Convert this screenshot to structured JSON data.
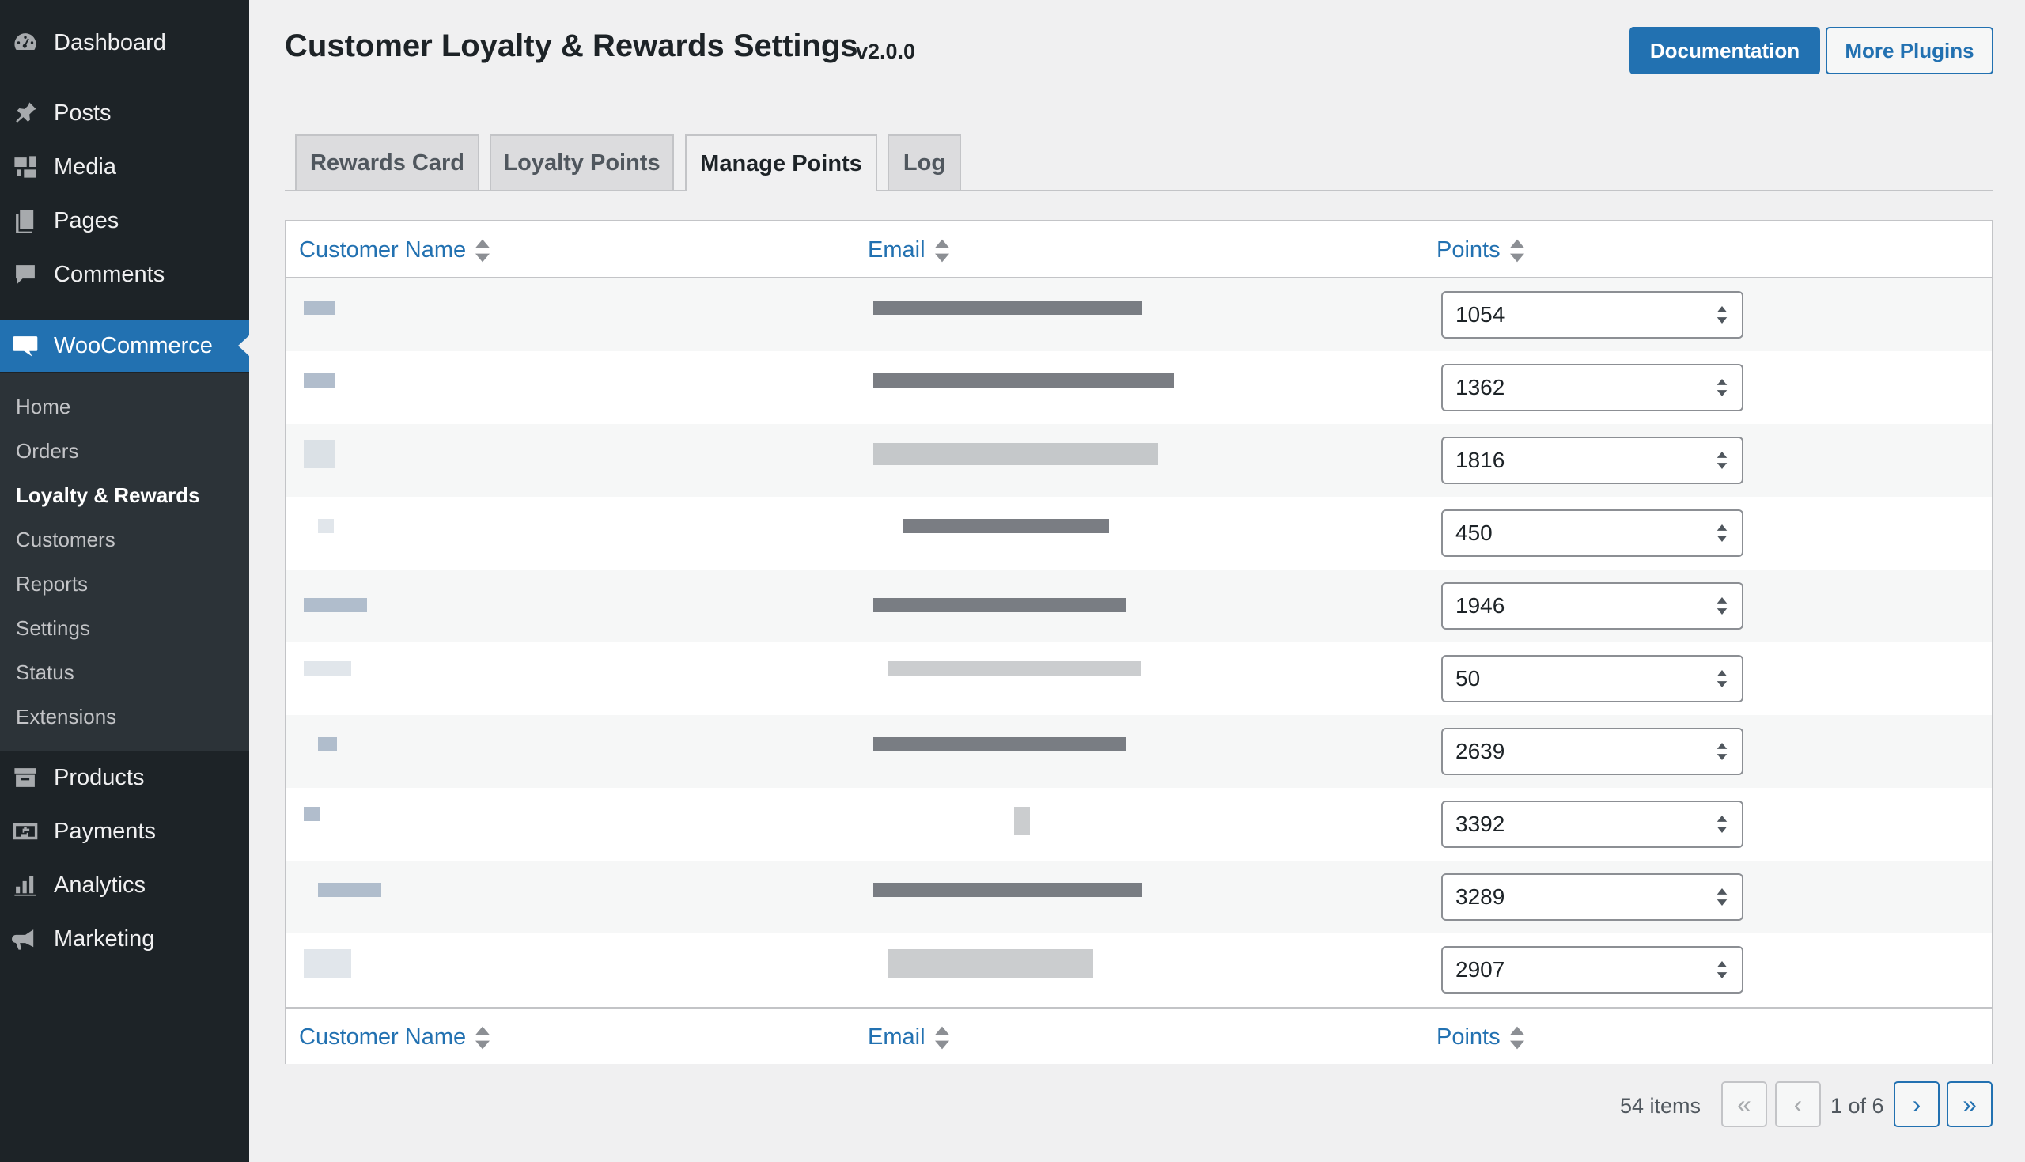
{
  "sidebar": {
    "top_items": [
      {
        "label": "Dashboard",
        "icon": "dashboard-icon"
      },
      {
        "label": "Posts",
        "icon": "pushpin-icon"
      },
      {
        "label": "Media",
        "icon": "media-icon"
      },
      {
        "label": "Pages",
        "icon": "pages-icon"
      },
      {
        "label": "Comments",
        "icon": "comment-icon"
      }
    ],
    "woocommerce": {
      "label": "WooCommerce",
      "icon": "woo-icon"
    },
    "submenu": [
      "Home",
      "Orders",
      "Loyalty & Rewards",
      "Customers",
      "Reports",
      "Settings",
      "Status",
      "Extensions"
    ],
    "current_submenu": "Loyalty & Rewards",
    "bottom_items": [
      {
        "label": "Products",
        "icon": "archive-icon"
      },
      {
        "label": "Payments",
        "icon": "money-icon"
      },
      {
        "label": "Analytics",
        "icon": "chart-bar-icon"
      },
      {
        "label": "Marketing",
        "icon": "megaphone-icon"
      }
    ]
  },
  "header": {
    "title": "Customer Loyalty & Rewards Settings",
    "version": "v2.0.0",
    "documentation_label": "Documentation",
    "more_plugins_label": "More Plugins"
  },
  "tabs": [
    {
      "label": "Rewards Card",
      "active": false
    },
    {
      "label": "Loyalty Points",
      "active": false
    },
    {
      "label": "Manage Points",
      "active": true
    },
    {
      "label": "Log",
      "active": false
    }
  ],
  "table": {
    "columns": [
      "Customer Name",
      "Email",
      "Points"
    ],
    "rows": [
      {
        "points": "1054"
      },
      {
        "points": "1362"
      },
      {
        "points": "1816"
      },
      {
        "points": "450"
      },
      {
        "points": "1946"
      },
      {
        "points": "50"
      },
      {
        "points": "2639"
      },
      {
        "points": "3392"
      },
      {
        "points": "3289"
      },
      {
        "points": "2907"
      }
    ]
  },
  "pagination": {
    "items_count": "54 items",
    "page_of": "1 of 6",
    "first": "«",
    "prev": "‹",
    "next": "›",
    "last": "»"
  },
  "colors": {
    "sidebar_bg": "#1d2327",
    "accent": "#2271b1",
    "page_bg": "#f0f0f1"
  }
}
